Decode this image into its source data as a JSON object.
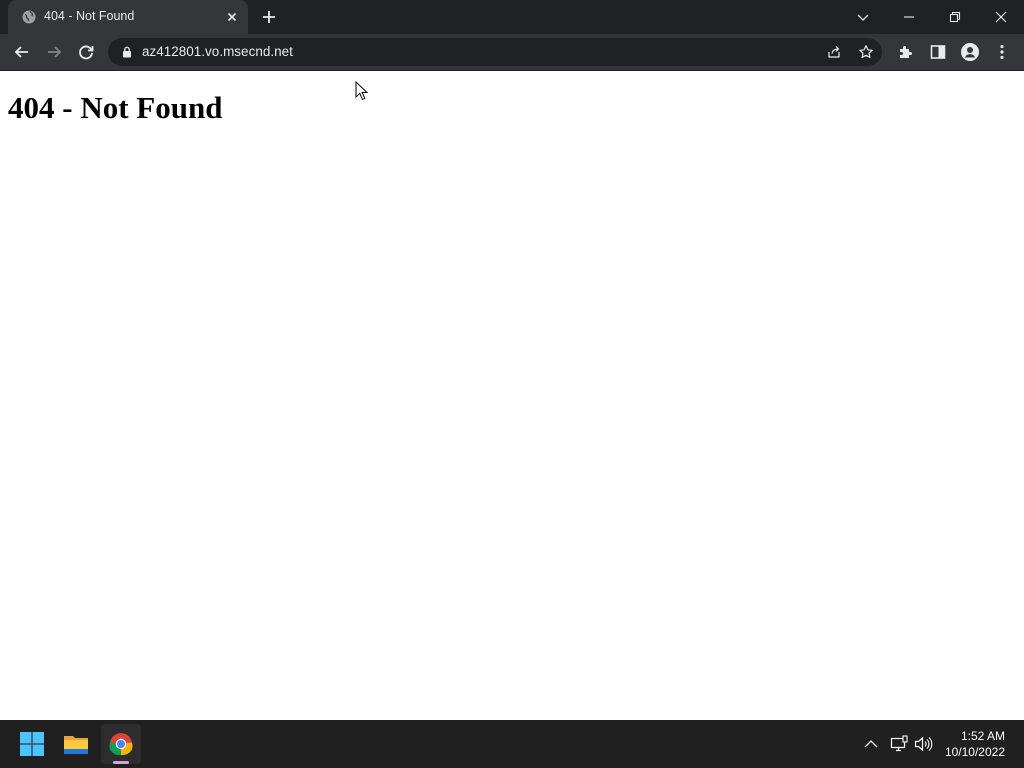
{
  "browser": {
    "tab": {
      "title": "404 - Not Found",
      "favicon": "globe-icon"
    },
    "new_tab_icon": "plus-icon",
    "window_controls": [
      "tab-search-chevron-icon",
      "minimize-icon",
      "restore-icon",
      "close-icon"
    ],
    "nav": {
      "back": "arrow-left-icon",
      "forward": "arrow-right-icon",
      "reload": "reload-icon"
    },
    "omnibox": {
      "lock_icon": "lock-icon",
      "url": "az412801.vo.msecnd.net",
      "share_icon": "share-icon",
      "bookmark_icon": "star-icon"
    },
    "toolbar_right": [
      "puzzle-icon",
      "side-panel-icon",
      "profile-icon",
      "kebab-menu-icon"
    ]
  },
  "page": {
    "heading": "404 - Not Found"
  },
  "taskbar": {
    "apps": [
      "windows-start-icon",
      "file-explorer-icon",
      "chrome-icon"
    ],
    "tray": [
      "chevron-up-icon",
      "network-icon",
      "volume-icon"
    ],
    "time": "1:52 AM",
    "date": "10/10/2022"
  },
  "colors": {
    "titlebar": "#202124",
    "toolbar": "#35363a",
    "text_light": "#e8eaed",
    "taskbar": "#202020",
    "active_indicator": "#d1a3e0"
  }
}
